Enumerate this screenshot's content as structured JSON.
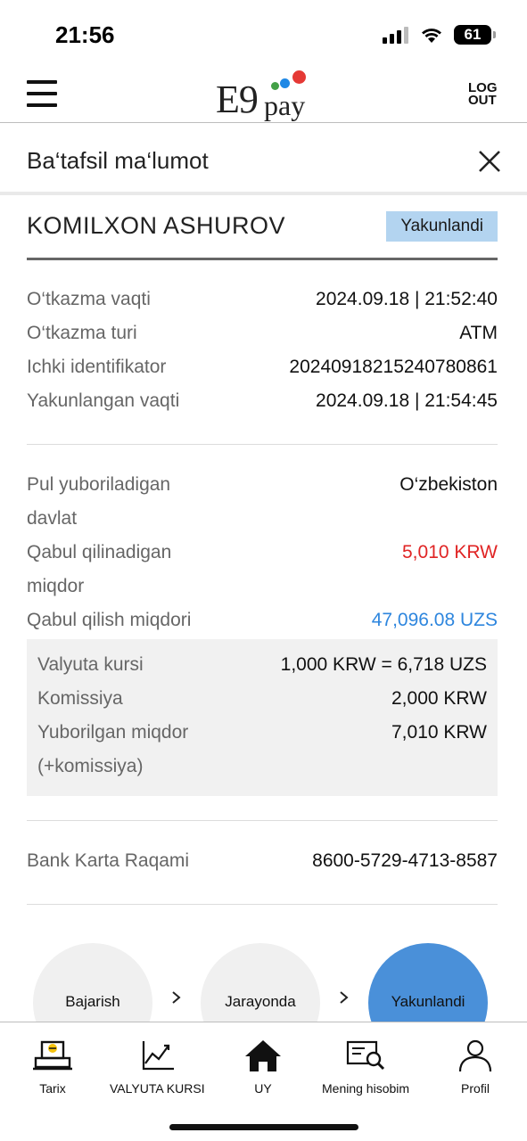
{
  "status_bar": {
    "time": "21:56",
    "battery": "61"
  },
  "header": {
    "logo_main": "E9",
    "logo_sub": "pay",
    "logout_line1": "LOG",
    "logout_line2": "OUT",
    "logo_dot_colors": [
      "#e53935",
      "#1e88e5",
      "#43a047"
    ]
  },
  "sub_header": {
    "title": "Ba‘tafsil ma‘lumot"
  },
  "recipient": {
    "name": "KOMILXON ASHUROV",
    "status": "Yakunlandi"
  },
  "transfer_info": [
    {
      "label": "O‘tkazma vaqti",
      "value": "2024.09.18 | 21:52:40"
    },
    {
      "label": "O‘tkazma turi",
      "value": "ATM"
    },
    {
      "label": "Ichki identifikator",
      "value": "20240918215240780861"
    },
    {
      "label": "Yakunlangan vaqti",
      "value": "2024.09.18 | 21:54:45"
    }
  ],
  "amounts": {
    "country_label_1": "Pul yuboriladigan",
    "country_label_2": "davlat",
    "country_value": "O‘zbekiston",
    "receive_amount_label_1": "Qabul qilinadigan",
    "receive_amount_label_2": "miqdor",
    "receive_amount_value": "5,010 KRW",
    "receive_value_label": "Qabul qilish miqdori",
    "receive_value": "47,096.08 UZS"
  },
  "fees": {
    "rate_label": "Valyuta kursi",
    "rate_value": "1,000 KRW = 6,718 UZS",
    "commission_label": "Komissiya",
    "commission_value": "2,000 KRW",
    "sent_label_1": "Yuborilgan miqdor",
    "sent_label_2": "(+komissiya)",
    "sent_value": "7,010 KRW"
  },
  "bank": {
    "label": "Bank Karta Raqami",
    "value": "8600-5729-4713-8587"
  },
  "stepper": {
    "steps": [
      "Bajarish",
      "Jarayonda",
      "Yakunlandi"
    ],
    "active_index": 2,
    "active_color": "#4a90d9"
  },
  "bottom_nav": {
    "items": [
      {
        "label": "Tarix",
        "icon": "receipt-printer-icon"
      },
      {
        "label": "VALYUTA KURSI",
        "icon": "chart-line-icon"
      },
      {
        "label": "UY",
        "icon": "home-icon"
      },
      {
        "label": "Mening hisobim",
        "icon": "account-search-icon"
      },
      {
        "label": "Profil",
        "icon": "user-icon"
      }
    ]
  }
}
